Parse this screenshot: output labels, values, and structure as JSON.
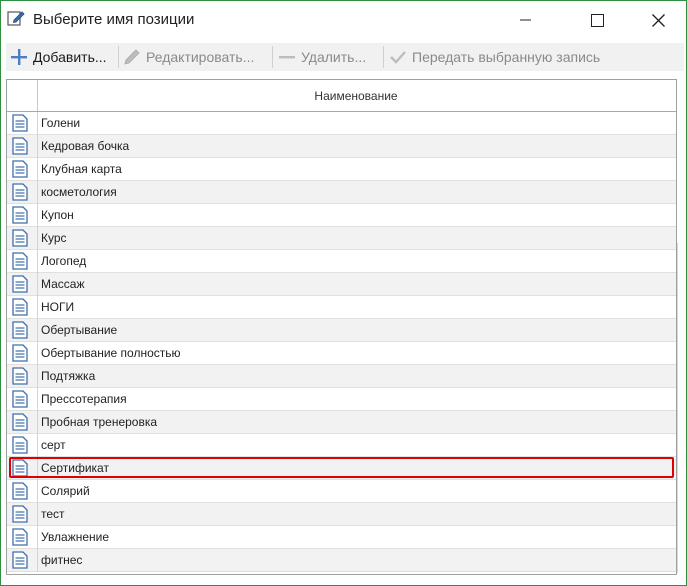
{
  "window": {
    "title": "Выберите имя позиции"
  },
  "toolbar": {
    "add_label": "Добавить...",
    "edit_label": "Редактировать...",
    "delete_label": "Удалить...",
    "transfer_label": "Передать выбранную запись"
  },
  "grid": {
    "column_header": "Наименование",
    "rows": [
      "Голени",
      "Кедровая бочка",
      "Клубная карта",
      "косметология",
      "Купон",
      "Курс",
      "Логопед",
      "Массаж",
      "НОГИ",
      "Обертывание",
      "Обертывание полностью",
      "Подтяжка",
      "Прессотерапия",
      "Пробная тренеровка",
      "серт",
      "Сертификат",
      "Солярий",
      "тест",
      "Увлажнение",
      "фитнес"
    ],
    "selected_index": 15
  },
  "colors": {
    "highlight": "#e00000",
    "add_icon": "#4a7fc1",
    "window_border": "#2f8f3f"
  }
}
